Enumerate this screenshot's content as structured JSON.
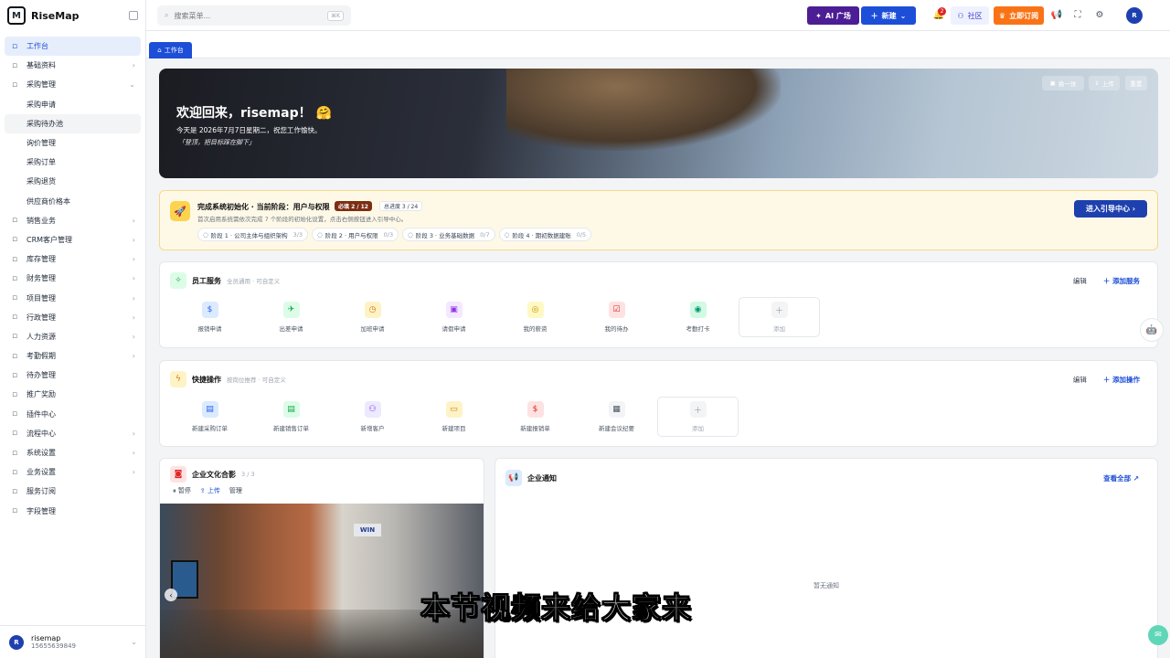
{
  "app": {
    "name": "RiseMap",
    "logo_letter": "M"
  },
  "sidebar": {
    "items": [
      {
        "label": "工作台",
        "icon": "dashboard-icon",
        "active": true
      },
      {
        "label": "基础资料",
        "icon": "cube-icon",
        "arrow": "›"
      },
      {
        "label": "采购管理",
        "icon": "cart-icon",
        "arrow": "⌄"
      },
      {
        "label": "采购申请",
        "sub": true
      },
      {
        "label": "采购待办池",
        "sub": true,
        "hover": true
      },
      {
        "label": "询价管理",
        "sub": true
      },
      {
        "label": "采购订单",
        "sub": true
      },
      {
        "label": "采购退货",
        "sub": true
      },
      {
        "label": "供应商价格本",
        "sub": true
      },
      {
        "label": "销售业务",
        "icon": "document-icon",
        "arrow": "›"
      },
      {
        "label": "CRM客户管理",
        "icon": "crm-icon",
        "arrow": "›"
      },
      {
        "label": "库存管理",
        "icon": "boxes-icon",
        "arrow": "›"
      },
      {
        "label": "财务管理",
        "icon": "wallet-icon",
        "arrow": "›"
      },
      {
        "label": "项目管理",
        "icon": "project-icon",
        "arrow": "›"
      },
      {
        "label": "行政管理",
        "icon": "building-icon",
        "arrow": "›"
      },
      {
        "label": "人力资源",
        "icon": "people-icon",
        "arrow": "›"
      },
      {
        "label": "考勤假期",
        "icon": "clock-icon",
        "arrow": "›"
      },
      {
        "label": "待办管理",
        "icon": "checklist-icon"
      },
      {
        "label": "推广奖励",
        "icon": "megaphone-icon"
      },
      {
        "label": "插件中心",
        "icon": "plugin-icon"
      },
      {
        "label": "流程中心",
        "icon": "flow-icon",
        "arrow": "›"
      },
      {
        "label": "系统设置",
        "icon": "gear-icon",
        "arrow": "›"
      },
      {
        "label": "业务设置",
        "icon": "briefcase-icon",
        "arrow": "›"
      },
      {
        "label": "服务订阅",
        "icon": "check-circle-icon"
      },
      {
        "label": "字段管理",
        "icon": "settings-icon"
      }
    ],
    "user": {
      "initial": "R",
      "name": "risemap",
      "phone": "15655639849"
    }
  },
  "topbar": {
    "search_placeholder": "搜索菜单...",
    "search_kbd": "⌘K",
    "ai_label": "AI 广场",
    "new_label": "新建",
    "notify_count": "2",
    "community_label": "社区",
    "subscribe_label": "立即订阅",
    "avatar": "R"
  },
  "tab": {
    "label": "工作台"
  },
  "hero": {
    "greeting": "欢迎回来，risemap！ 🤗",
    "date_line": "今天是 2026年7月7日星期二，祝您工作愉快。",
    "quote": "「登顶，把目标踩在脚下」",
    "btn_switch": "换一张",
    "btn_upload": "上传",
    "btn_reset": "重置"
  },
  "onboarding": {
    "title": "完成系统初始化 · 当前阶段：用户与权限",
    "required": "必填 2 / 12",
    "progress": "总进度 3 / 24",
    "desc": "首次启用系统需依次完成 7 个阶段的初始化设置，点击右侧按钮进入引导中心。",
    "cta": "进入引导中心 ›",
    "stages": [
      {
        "label": "阶段 1 · 公司主体与组织架构",
        "count": "3/3"
      },
      {
        "label": "阶段 2 · 用户与权限",
        "count": "0/3"
      },
      {
        "label": "阶段 3 · 业务基础数据",
        "count": "0/7"
      },
      {
        "label": "阶段 4 · 期初数据建账",
        "count": "0/5"
      }
    ]
  },
  "services": {
    "title": "员工服务",
    "subtitle": "全员通用 · 可自定义",
    "edit": "编辑",
    "add": "＋ 添加服务",
    "items": [
      {
        "label": "报销申请",
        "glyph": "$",
        "color": "#2563eb",
        "bg": "#dbeafe"
      },
      {
        "label": "出差申请",
        "glyph": "✈",
        "color": "#16a34a",
        "bg": "#dcfce7"
      },
      {
        "label": "加班申请",
        "glyph": "◷",
        "color": "#d97706",
        "bg": "#fef3c7"
      },
      {
        "label": "请假申请",
        "glyph": "▣",
        "color": "#9333ea",
        "bg": "#f3e8ff"
      },
      {
        "label": "我的薪资",
        "glyph": "◎",
        "color": "#ca8a04",
        "bg": "#fef9c3"
      },
      {
        "label": "我的待办",
        "glyph": "☑",
        "color": "#dc2626",
        "bg": "#fee2e2"
      },
      {
        "label": "考勤打卡",
        "glyph": "◉",
        "color": "#059669",
        "bg": "#d1fae5"
      }
    ],
    "add_tile": "添加"
  },
  "quick": {
    "title": "快捷操作",
    "subtitle": "按岗位推荐 · 可自定义",
    "edit": "编辑",
    "add": "＋ 添加操作",
    "items": [
      {
        "label": "新建采购订单",
        "glyph": "▤",
        "color": "#2563eb",
        "bg": "#dbeafe"
      },
      {
        "label": "新建销售订单",
        "glyph": "▤",
        "color": "#16a34a",
        "bg": "#dcfce7"
      },
      {
        "label": "新增客户",
        "glyph": "⚇",
        "color": "#7c3aed",
        "bg": "#ede9fe"
      },
      {
        "label": "新建项目",
        "glyph": "▭",
        "color": "#d97706",
        "bg": "#fef3c7"
      },
      {
        "label": "新建报销单",
        "glyph": "$",
        "color": "#dc2626",
        "bg": "#fee2e2"
      },
      {
        "label": "新建会议纪要",
        "glyph": "▦",
        "color": "#4b5563",
        "bg": "#f3f4f6"
      }
    ],
    "add_tile": "添加"
  },
  "culture": {
    "title": "企业文化合影",
    "count": "3 / 3",
    "pause": "暂停",
    "upload": "上传",
    "manage": "管理",
    "sign": "WIN"
  },
  "notice": {
    "title": "企业通知",
    "view_all": "查看全部 ↗",
    "empty": "暂无通知"
  },
  "overlay": {
    "subtitle": "本节视频来给大家来"
  }
}
